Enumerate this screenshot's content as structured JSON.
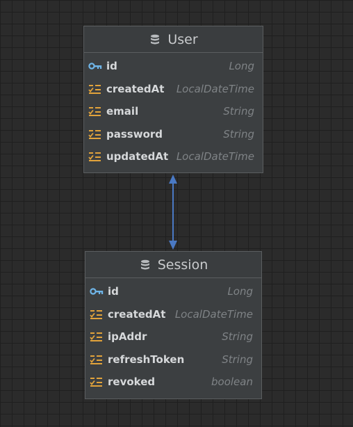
{
  "entities": [
    {
      "name": "User",
      "icon": "database-icon",
      "fields": [
        {
          "name": "id",
          "type": "Long",
          "icon": "primary-key-icon"
        },
        {
          "name": "createdAt",
          "type": "LocalDateTime",
          "icon": "column-icon"
        },
        {
          "name": "email",
          "type": "String",
          "icon": "column-icon"
        },
        {
          "name": "password",
          "type": "String",
          "icon": "column-icon"
        },
        {
          "name": "updatedAt",
          "type": "LocalDateTime",
          "icon": "column-icon"
        }
      ]
    },
    {
      "name": "Session",
      "icon": "database-icon",
      "fields": [
        {
          "name": "id",
          "type": "Long",
          "icon": "primary-key-icon"
        },
        {
          "name": "createdAt",
          "type": "LocalDateTime",
          "icon": "column-icon"
        },
        {
          "name": "ipAddr",
          "type": "String",
          "icon": "column-icon"
        },
        {
          "name": "refreshToken",
          "type": "String",
          "icon": "column-icon"
        },
        {
          "name": "revoked",
          "type": "boolean",
          "icon": "column-icon"
        }
      ]
    }
  ],
  "relation": {
    "from": "User",
    "to": "Session",
    "style": "bidirectional",
    "color": "#4a79c4"
  },
  "colors": {
    "background": "#2b2b2b",
    "grid": "#1f1f1f",
    "entity_fill": "#3c3f41",
    "entity_border": "#5b5e60",
    "key_icon": "#6fb5e8",
    "column_icon": "#e2a33b"
  }
}
